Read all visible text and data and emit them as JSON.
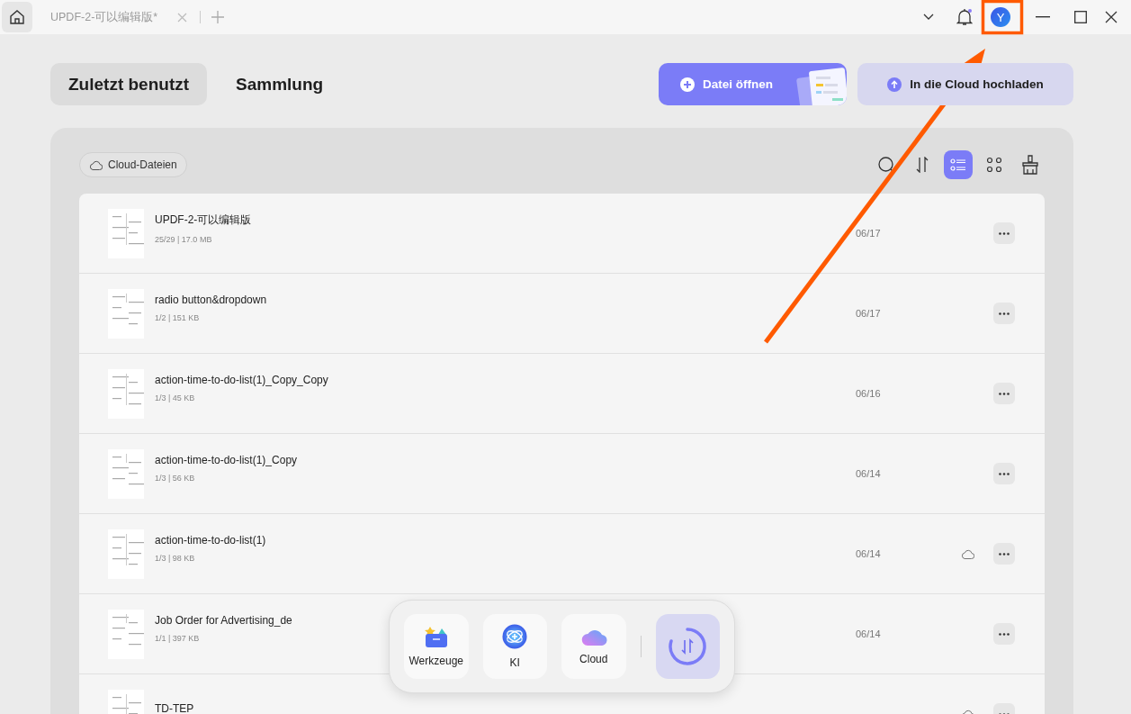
{
  "title_bar": {
    "home_selected": true,
    "tabs": [
      {
        "label": "UPDF-2-可以编辑版*",
        "selected": false
      }
    ],
    "avatar": "Y",
    "notification_dot": true
  },
  "views": [
    {
      "label": "Zuletzt benutzt",
      "selected": true
    },
    {
      "label": "Sammlung",
      "selected": false
    }
  ],
  "actions": [
    {
      "label": "Datei öffnen",
      "kind": "primary"
    },
    {
      "label": "In die Cloud hochladen",
      "kind": "secondary"
    }
  ],
  "filter": {
    "label": "Cloud-Dateien"
  },
  "view_buttons": [
    {
      "kind": "list",
      "selected": true
    },
    {
      "kind": "grid",
      "selected": false
    }
  ],
  "files": [
    {
      "name": "UPDF-2-可以编辑版",
      "meta": "25/29 | 17.0 MB",
      "date": "06/17",
      "cloud": false
    },
    {
      "name": "radio button&dropdown",
      "meta": "1/2 | 151 KB",
      "date": "06/17",
      "cloud": false
    },
    {
      "name": "action-time-to-do-list(1)_Copy_Copy",
      "meta": "1/3 | 45 KB",
      "date": "06/16",
      "cloud": false
    },
    {
      "name": "action-time-to-do-list(1)_Copy",
      "meta": "1/3 | 56 KB",
      "date": "06/14",
      "cloud": false
    },
    {
      "name": "action-time-to-do-list(1)",
      "meta": "1/3 | 98 KB",
      "date": "06/14",
      "cloud": true
    },
    {
      "name": "Job Order for Advertising_de",
      "meta": "1/1 | 397 KB",
      "date": "06/14",
      "cloud": false
    },
    {
      "name": "TD-TEP",
      "cloud": true
    }
  ],
  "dock": [
    {
      "label": "Werkzeuge",
      "kind": "tools"
    },
    {
      "label": "KI",
      "kind": "ai"
    },
    {
      "label": "Cloud",
      "kind": "cloud"
    }
  ]
}
